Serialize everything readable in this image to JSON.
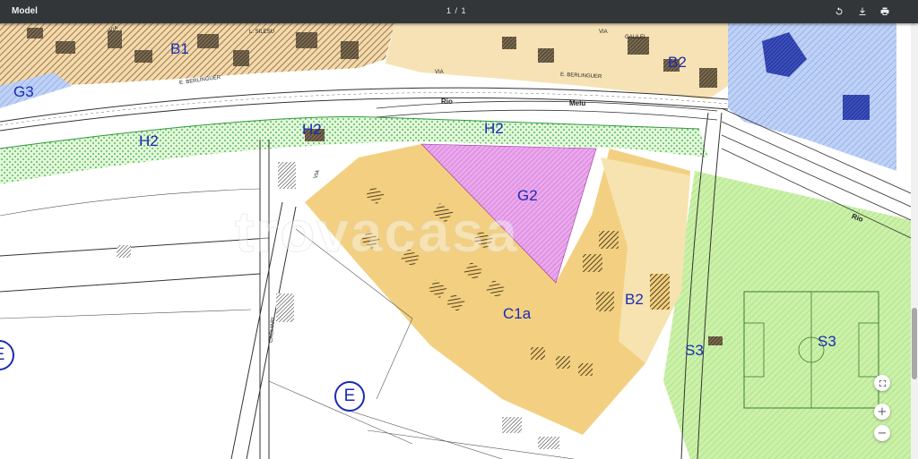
{
  "viewer": {
    "title": "Model",
    "page_counter": "1 / 1",
    "rotate_icon": "rotate-icon",
    "download_icon": "download-icon",
    "print_icon": "print-icon"
  },
  "zoom_controls": {
    "fit_icon": "fit-to-page-icon",
    "zoom_in_label": "+",
    "zoom_out_label": "−"
  },
  "map": {
    "watermark": "trovacasa",
    "zones": [
      {
        "id": "b1",
        "label": "B1"
      },
      {
        "id": "b2-top",
        "label": "B2"
      },
      {
        "id": "g3",
        "label": "G3"
      },
      {
        "id": "h2-left",
        "label": "H2"
      },
      {
        "id": "h2-mid",
        "label": "H2"
      },
      {
        "id": "h2-right",
        "label": "H2"
      },
      {
        "id": "g2",
        "label": "G2"
      },
      {
        "id": "c1a",
        "label": "C1a"
      },
      {
        "id": "b2-mid",
        "label": "B2"
      },
      {
        "id": "s3-left",
        "label": "S3"
      },
      {
        "id": "s3-right",
        "label": "S3"
      },
      {
        "id": "e-left",
        "label": "E"
      },
      {
        "id": "e-center",
        "label": "E"
      }
    ],
    "streets": {
      "via_top_left": "VIA",
      "berlinguer_left": "E. BERLINGUER",
      "via_center": "VIA",
      "berlinguer_right": "E. BERLINGUER",
      "silesu": "L. SILESU",
      "galilei": "GALILEI",
      "via_galilei": "VIA",
      "cagliari": "CAGLIARI",
      "via_left": "VIA",
      "rio_left": "Rio",
      "melu": "Melu",
      "rio_right": "Rio"
    },
    "colors": {
      "residential_b": "#f3d7a9",
      "agricultural_h": "#d8f5c9",
      "park_g2": "#e9a5ea",
      "expansion_c1a": "#f2cd7a",
      "sport_s3": "#c9f1a6",
      "green_g3": "#bcd0f5",
      "label_blue": "#1a2bb3"
    }
  }
}
